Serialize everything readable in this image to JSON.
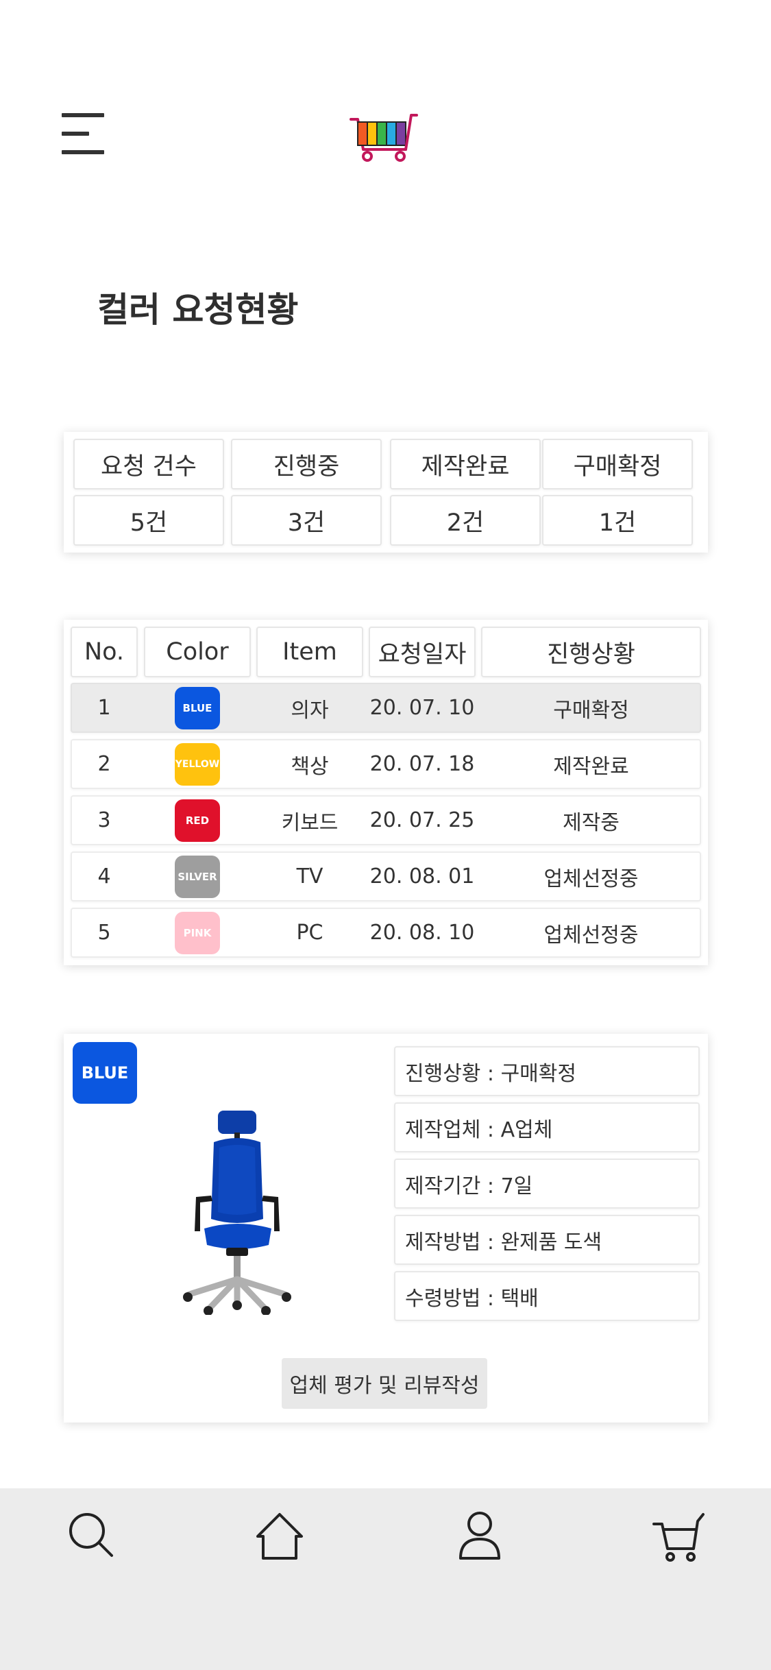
{
  "header": {
    "menu_icon": "hamburger-menu-icon",
    "logo_icon": "rainbow-shopping-cart-logo"
  },
  "page_title": "컬러 요청현황",
  "summary": {
    "headers": [
      "요청 건수",
      "진행중",
      "제작완료",
      "구매확정"
    ],
    "values": [
      "5건",
      "3건",
      "2건",
      "1건"
    ]
  },
  "table": {
    "headers": [
      "No.",
      "Color",
      "Item",
      "요청일자",
      "진행상황"
    ],
    "rows": [
      {
        "no": "1",
        "color": "BLUE",
        "color_hex": "#0b57e0",
        "item": "의자",
        "date": "20. 07. 10",
        "status": "구매확정"
      },
      {
        "no": "2",
        "color": "YELLOW",
        "color_hex": "#ffc20e",
        "item": "책상",
        "date": "20. 07. 18",
        "status": "제작완료"
      },
      {
        "no": "3",
        "color": "RED",
        "color_hex": "#e0112b",
        "item": "키보드",
        "date": "20. 07. 25",
        "status": "제작중"
      },
      {
        "no": "4",
        "color": "SILVER",
        "color_hex": "#9e9e9e",
        "item": "TV",
        "date": "20. 08. 01",
        "status": "업체선정중"
      },
      {
        "no": "5",
        "color": "PINK",
        "color_hex": "#ffc0cb",
        "item": "PC",
        "date": "20. 08. 10",
        "status": "업체선정중"
      }
    ]
  },
  "detail": {
    "badge": "BLUE",
    "badge_hex": "#0b57e0",
    "image": "blue-office-chair",
    "info": [
      "진행상황 : 구매확정",
      "제작업체 : A업체",
      "제작기간 : 7일",
      "제작방법 : 완제품 도색",
      "수령방법 : 택배"
    ],
    "review_button": "업체 평가 및 리뷰작성"
  },
  "bottom_nav": {
    "icons": [
      "search-icon",
      "home-icon",
      "user-icon",
      "cart-icon"
    ]
  }
}
